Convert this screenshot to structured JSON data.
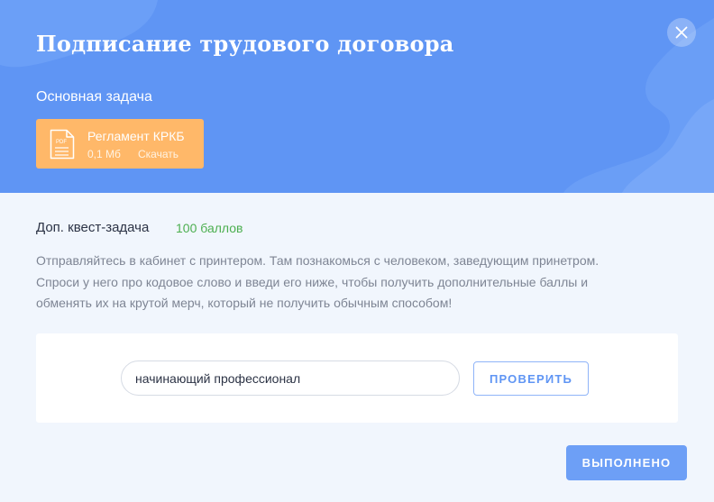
{
  "colors": {
    "header_bg": "#5f95f4",
    "file_card_bg": "#ffb869",
    "points_green": "#4caf50",
    "accent_blue": "#5f95f4",
    "panel_bg": "#f1f6fd"
  },
  "modal": {
    "title": "Подписание трудового договора",
    "close_icon": "close-icon"
  },
  "main_task": {
    "label": "Основная задача",
    "file": {
      "icon": "pdf-file-icon",
      "icon_text": "PDF",
      "name": "Регламент КРКБ",
      "size": "0,1 Мб",
      "download_label": "Скачать"
    }
  },
  "quest": {
    "label": "Доп. квест-задача",
    "points": "100 баллов",
    "description_lines": [
      "Отправляйтесь в кабинет с принтером. Там познакомься с человеком, заведующим принетром.",
      "Спроси у него про кодовое слово и введи его ниже, чтобы получить дополнительные баллы и",
      "обменять их на крутой мерч, который не получить обычным способом!"
    ],
    "input_value": "начинающий профессионал",
    "check_label": "ПРОВЕРИТЬ"
  },
  "footer": {
    "done_label": "ВЫПОЛНЕНО"
  }
}
